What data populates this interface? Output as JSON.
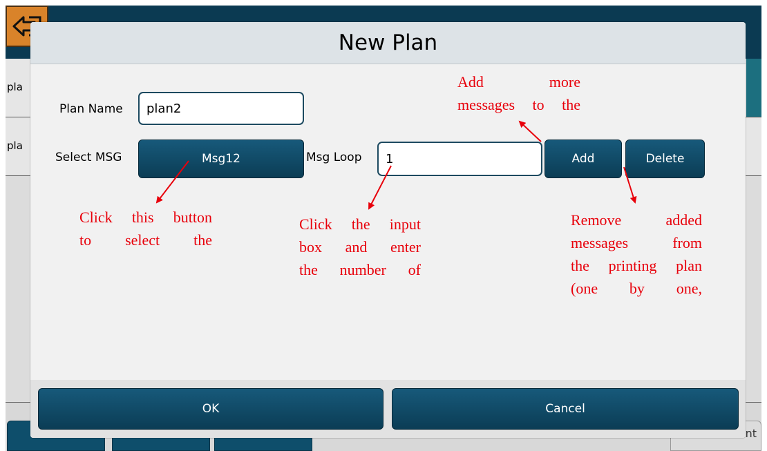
{
  "background": {
    "rows": [
      {
        "label": "pla"
      },
      {
        "label": "pla"
      }
    ],
    "bottom_right_label": "nt"
  },
  "dialog": {
    "title": "New Plan",
    "plan_name_label": "Plan Name",
    "plan_name_value": "plan2",
    "select_msg_label": "Select MSG",
    "select_msg_value": "Msg12",
    "msg_loop_label": "Msg Loop",
    "msg_loop_value": "1",
    "add_label": "Add",
    "delete_label": "Delete",
    "ok_label": "OK",
    "cancel_label": "Cancel"
  },
  "annotations": {
    "add_note_line1": "Add more",
    "add_note_line2": "messages to the",
    "select_note_line1": "Click this button",
    "select_note_line2": "to select the",
    "loop_note_line1": "Click the input",
    "loop_note_line2": "box and enter",
    "loop_note_line3": "the number of",
    "delete_note_line1": "Remove added",
    "delete_note_line2": "messages from",
    "delete_note_line3": "the printing plan",
    "delete_note_line4": "(one by one,"
  },
  "colors": {
    "button": "#0e4e6b",
    "annotation": "#e8000b",
    "back_button": "#d9832a"
  },
  "icons": {
    "back": "back-arrow-icon"
  }
}
